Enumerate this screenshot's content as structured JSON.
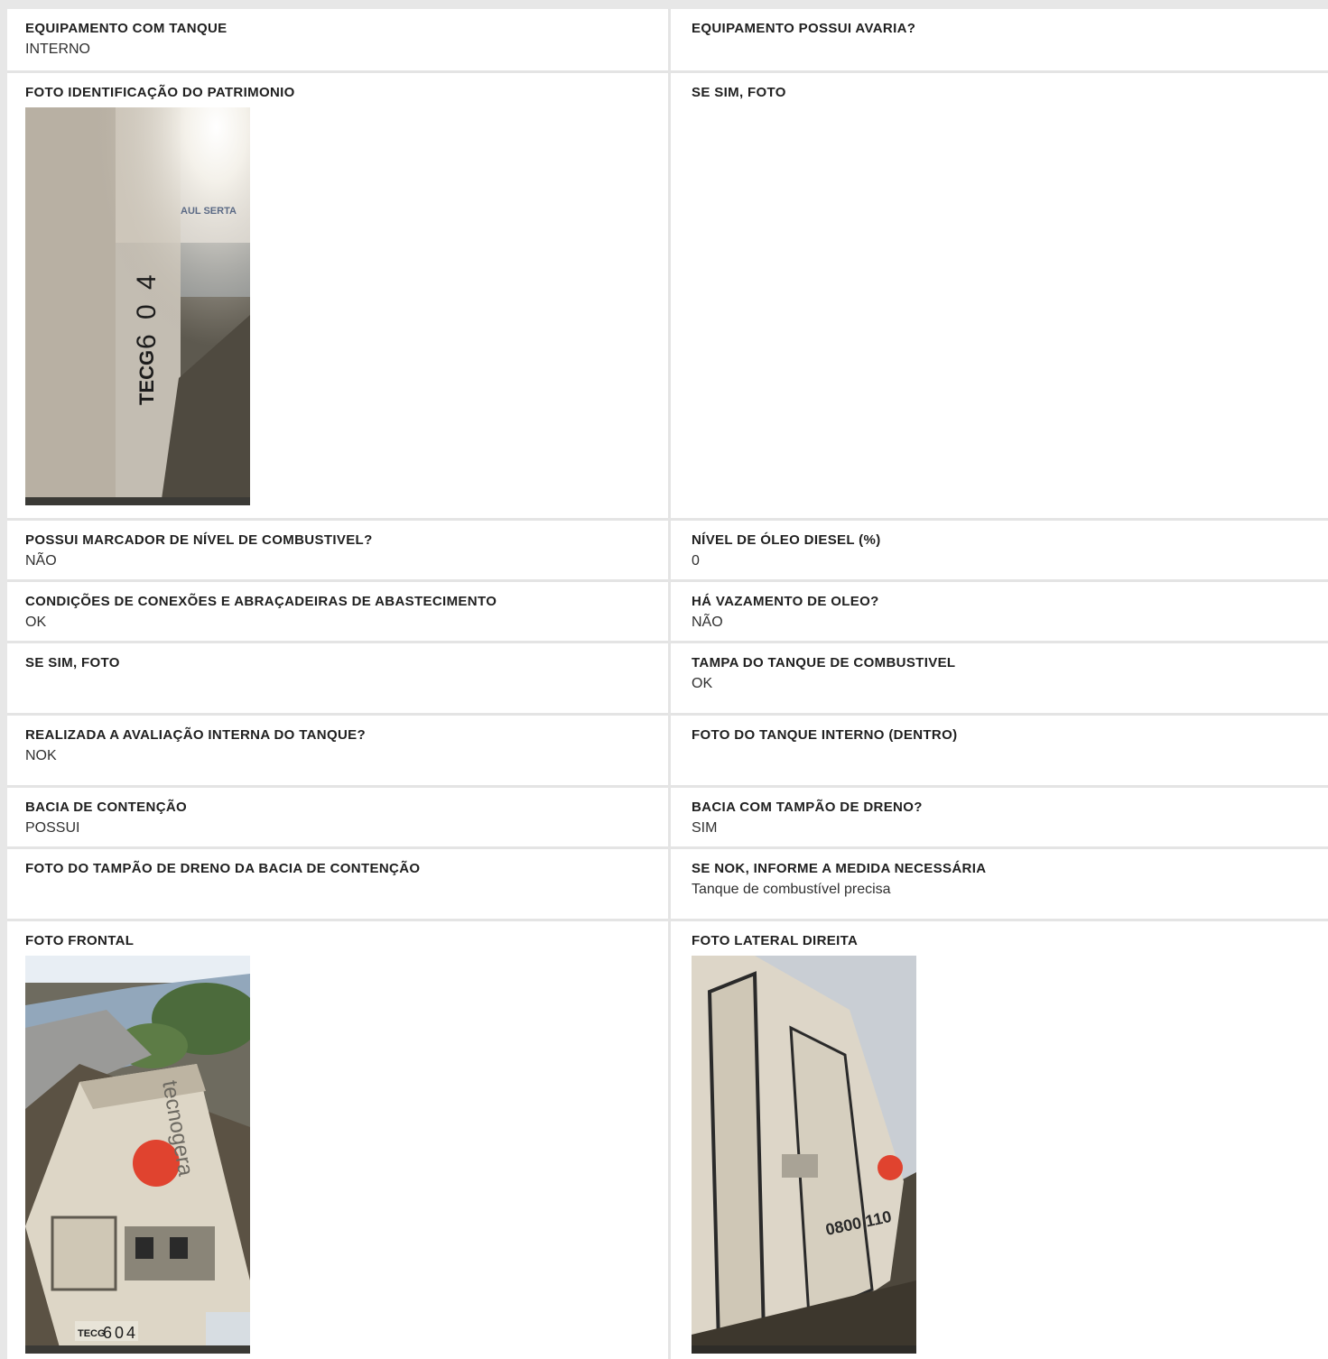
{
  "rows": [
    {
      "left": {
        "label": "EQUIPAMENTO COM TANQUE",
        "value": "INTERNO"
      },
      "right": {
        "label": "EQUIPAMENTO POSSUI AVARIA?",
        "value": ""
      }
    },
    {
      "left": {
        "label": "FOTO IDENTIFICAÇÃO DO PATRIMONIO",
        "photo": {
          "sign_text": "AUL SERTA",
          "plate_prefix": "TECG",
          "plate_digits": [
            "6",
            "0",
            "4"
          ]
        }
      },
      "right": {
        "label": "SE SIM, FOTO",
        "value": ""
      }
    },
    {
      "left": {
        "label": "POSSUI MARCADOR DE NÍVEL DE COMBUSTIVEL?",
        "value": "NÃO"
      },
      "right": {
        "label": "NÍVEL DE ÓLEO DIESEL (%)",
        "value": "0"
      }
    },
    {
      "left": {
        "label": "CONDIÇÕES DE CONEXÕES E ABRAÇADEIRAS DE ABASTECIMENTO",
        "value": "OK"
      },
      "right": {
        "label": "HÁ VAZAMENTO DE OLEO?",
        "value": "NÃO"
      }
    },
    {
      "left": {
        "label": "SE SIM, FOTO",
        "value": ""
      },
      "right": {
        "label": "TAMPA DO TANQUE DE COMBUSTIVEL",
        "value": "OK"
      }
    },
    {
      "left": {
        "label": "REALIZADA A AVALIAÇÃO INTERNA DO TANQUE?",
        "value": "NOK"
      },
      "right": {
        "label": "FOTO DO TANQUE INTERNO (DENTRO)",
        "value": ""
      }
    },
    {
      "left": {
        "label": "BACIA DE CONTENÇÃO",
        "value": "POSSUI"
      },
      "right": {
        "label": "BACIA COM TAMPÃO DE DRENO?",
        "value": "SIM"
      }
    },
    {
      "left": {
        "label": "FOTO DO TAMPÃO DE DRENO DA BACIA DE CONTENÇÃO",
        "value": ""
      },
      "right": {
        "label": "SE NOK, INFORME A MEDIDA NECESSÁRIA",
        "value": "Tanque de combustível precisa"
      }
    },
    {
      "left": {
        "label": "FOTO FRONTAL",
        "photo": {
          "brand_text": "tecnogera",
          "plate_prefix": "TECG",
          "plate_digits": [
            "6",
            "0",
            "4"
          ]
        }
      },
      "right": {
        "label": "FOTO LATERAL DIREITA",
        "photo": {
          "number_text": "0800 110"
        }
      }
    }
  ]
}
